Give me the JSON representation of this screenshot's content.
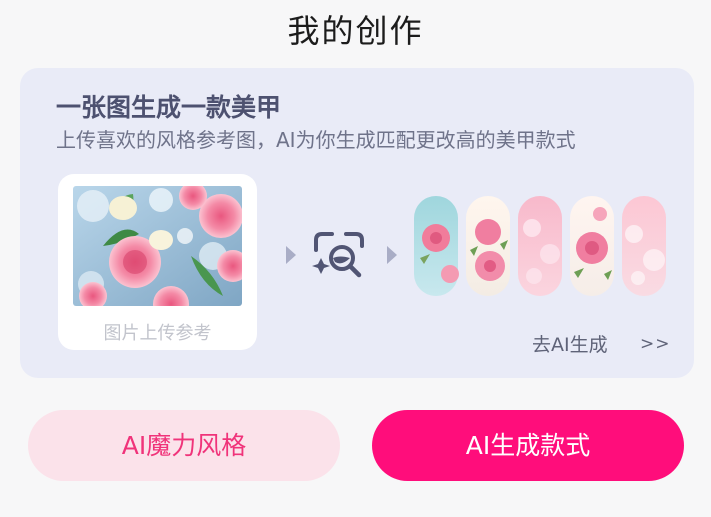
{
  "header": {
    "title": "我的创作"
  },
  "card": {
    "title": "一张图生成一款美甲",
    "subtitle": "上传喜欢的风格参考图，AI为你生成匹配更改高的美甲款式",
    "upload_label": "图片上传参考",
    "go_link": "去AI生成",
    "go_chevron": ">>"
  },
  "buttons": {
    "magic_style": "AI魔力风格",
    "generate_style": "AI生成款式"
  },
  "icons": {
    "arrow": "triangle-right-icon",
    "scan": "ai-scan-magnifier-icon"
  },
  "colors": {
    "accent": "#ff0d7b",
    "accent_light": "#fbe2ea",
    "card_bg": "#e9ebf7"
  }
}
